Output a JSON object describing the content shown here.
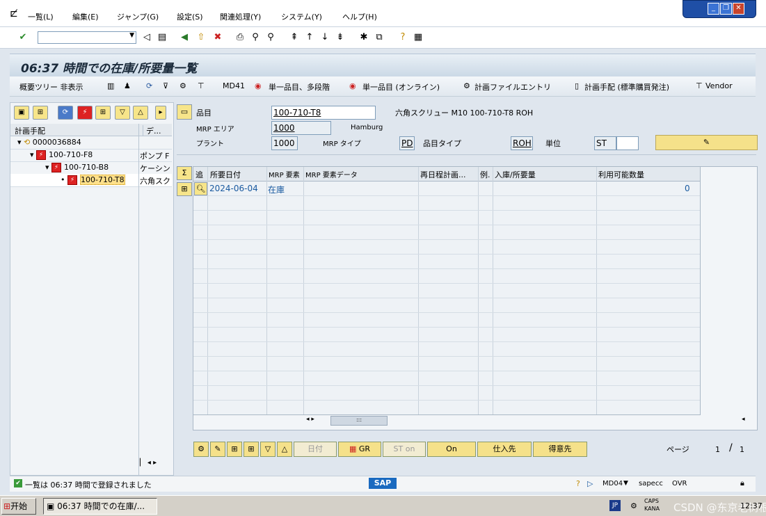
{
  "menu": [
    "一覧(L)",
    "編集(E)",
    "ジャンプ(G)",
    "設定(S)",
    "関連処理(Y)",
    "システム(Y)",
    "ヘルプ(H)"
  ],
  "title": "06:37 時間での在庫/所要量一覧",
  "app_toolbar": {
    "hide_tree": "概要ツリー 非表示",
    "md41": "MD41",
    "single_multi": "単一品目、多段階",
    "single_online": "単一品目 (オンライン)",
    "plan_file": "計画ファイルエントリ",
    "plan_proc": "計画手配 (標準購買発注)",
    "vendor": "Vendor"
  },
  "tree": {
    "col1": "計画手配",
    "col2": "デ...",
    "rows": [
      {
        "id": "0000036884",
        "desc": ""
      },
      {
        "id": "100-710-F8",
        "desc": "ポンプ F"
      },
      {
        "id": "100-710-B8",
        "desc": "ケーシン"
      },
      {
        "id": "100-710-T8",
        "desc": "六角スク"
      }
    ]
  },
  "header": {
    "material_label": "品目",
    "material": "100-710-T8",
    "material_desc": "六角スクリュー M10 100-710-T8 ROH",
    "mrp_area_label": "MRP エリア",
    "mrp_area": "1000",
    "mrp_area_name": "Hamburg",
    "plant_label": "プラント",
    "plant": "1000",
    "mrp_type_label": "MRP タイプ",
    "mrp_type": "PD",
    "mat_type_label": "品目タイプ",
    "mat_type": "ROH",
    "unit_label": "単位",
    "unit": "ST"
  },
  "grid": {
    "headers": [
      "追",
      "所要日付",
      "MRP 要素",
      "MRP 要素データ",
      "再日程計画...",
      "例.",
      "入庫/所要量",
      "利用可能数量"
    ],
    "rows": [
      {
        "date": "2024-06-04",
        "element": "在庫",
        "qty": "0"
      }
    ]
  },
  "bottom_buttons": {
    "date": "日付",
    "gr": "GR",
    "st_on": "ST on",
    "on": "On",
    "vendor": "仕入先",
    "customer": "得意先"
  },
  "page": {
    "label": "ページ",
    "current": "1",
    "total": "1"
  },
  "status": {
    "message": "一覧は 06:37 時間で登録されました",
    "tcode": "MD04",
    "server": "sapecc",
    "mode": "OVR"
  },
  "taskbar": {
    "start": "开始",
    "window": "06:37 時間での在庫/...",
    "lang": "JP",
    "ime": "CAPS KANA",
    "watermark": "CSDN @东京老树根",
    "clock": "12:37"
  }
}
